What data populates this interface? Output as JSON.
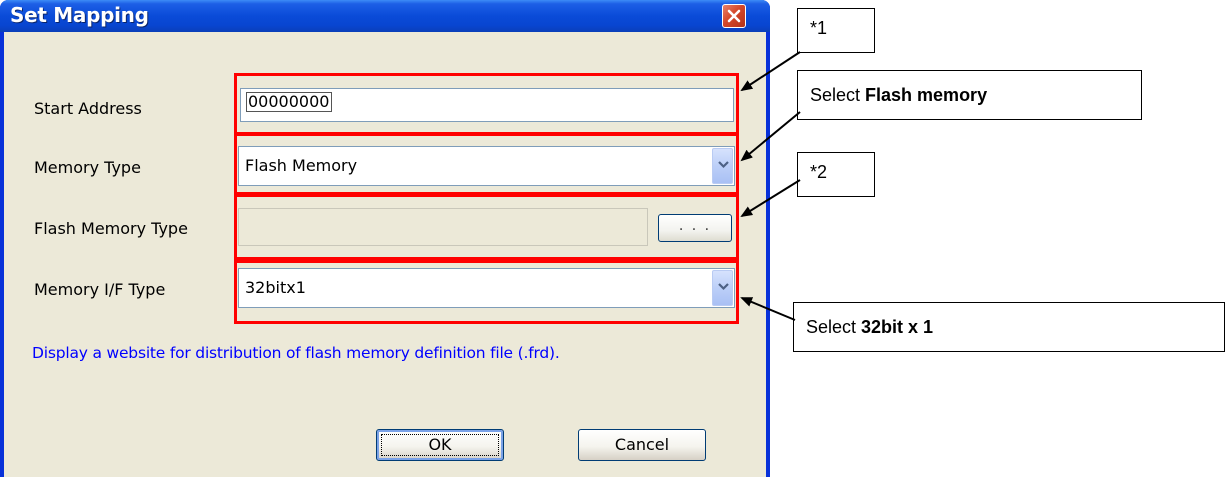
{
  "dialog": {
    "title": "Set Mapping",
    "close_icon": "close-x-icon"
  },
  "fields": {
    "start_address": {
      "label": "Start Address",
      "value": "00000000"
    },
    "memory_type": {
      "label": "Memory Type",
      "value": "Flash Memory"
    },
    "flash_memory_type": {
      "label": "Flash Memory Type",
      "value": "",
      "browse_label": ". . ."
    },
    "memory_if_type": {
      "label": "Memory I/F Type",
      "value": "32bitx1"
    }
  },
  "link": {
    "text": "Display a website for distribution of flash memory definition file (.frd)."
  },
  "buttons": {
    "ok": "OK",
    "cancel": "Cancel"
  },
  "callouts": {
    "note1": "*1",
    "select_flash_prefix": "Select ",
    "select_flash_bold": "Flash memory",
    "note2": "*2",
    "select_32_prefix": "Select ",
    "select_32_bold": "32bit x 1"
  },
  "colors": {
    "highlight": "#ff0000",
    "title_bar": "#0a4bd8",
    "link": "#0000ff",
    "client_bg": "#ece9d8"
  }
}
